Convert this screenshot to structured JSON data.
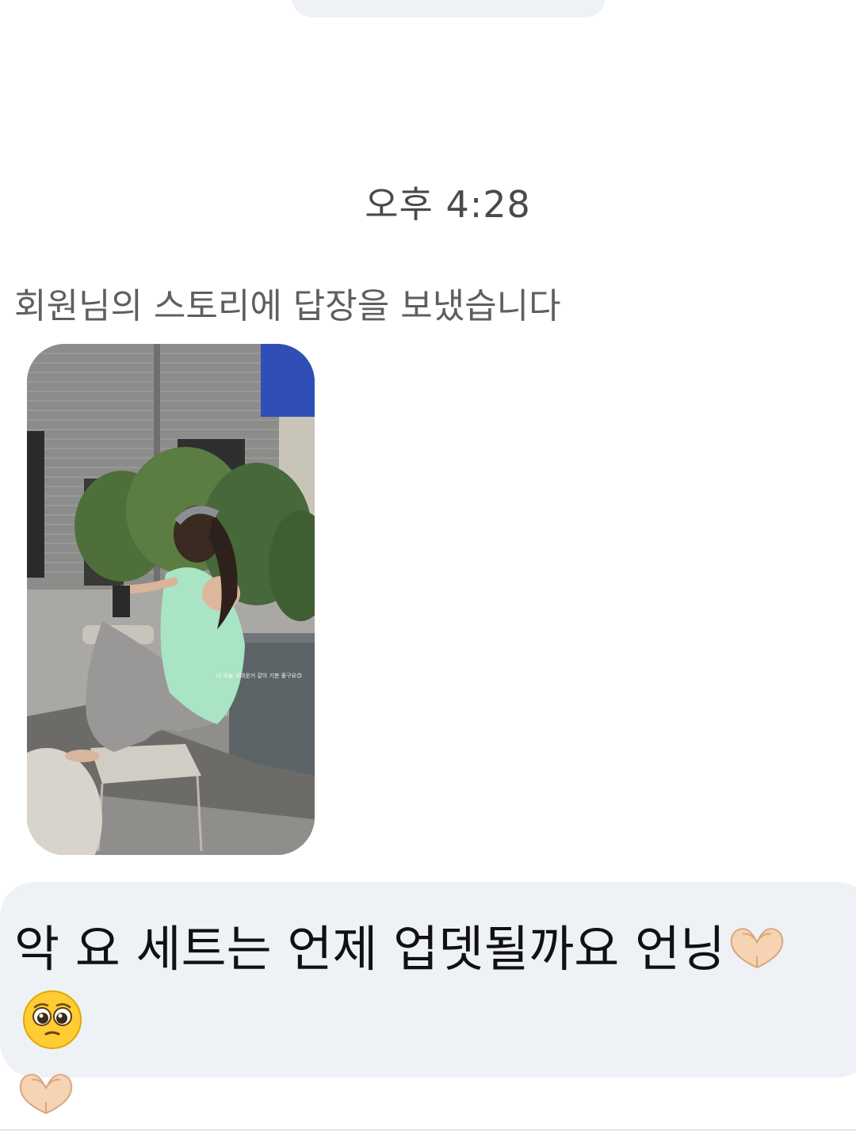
{
  "thread": {
    "timestamp": "오후 4:28",
    "story_reply_notice": "회원님의 스토리에 답장을 보냈습니다",
    "story_overlay_text": "나 오늘 귀여운거 같아 기분 좋구요😊",
    "message": {
      "text": "악 요 세트는 언제 업뎃될까요 언닝",
      "emoji_after_text": [
        "heart-hands-icon",
        "pleading-face-icon"
      ],
      "emoji_second_line": [
        "heart-hands-icon"
      ]
    }
  },
  "colors": {
    "background": "#ffffff",
    "bubble": "#eef1f5",
    "timestamp_text": "#4a4a4a",
    "notice_text": "#5f5f5f",
    "message_text": "#111111"
  }
}
